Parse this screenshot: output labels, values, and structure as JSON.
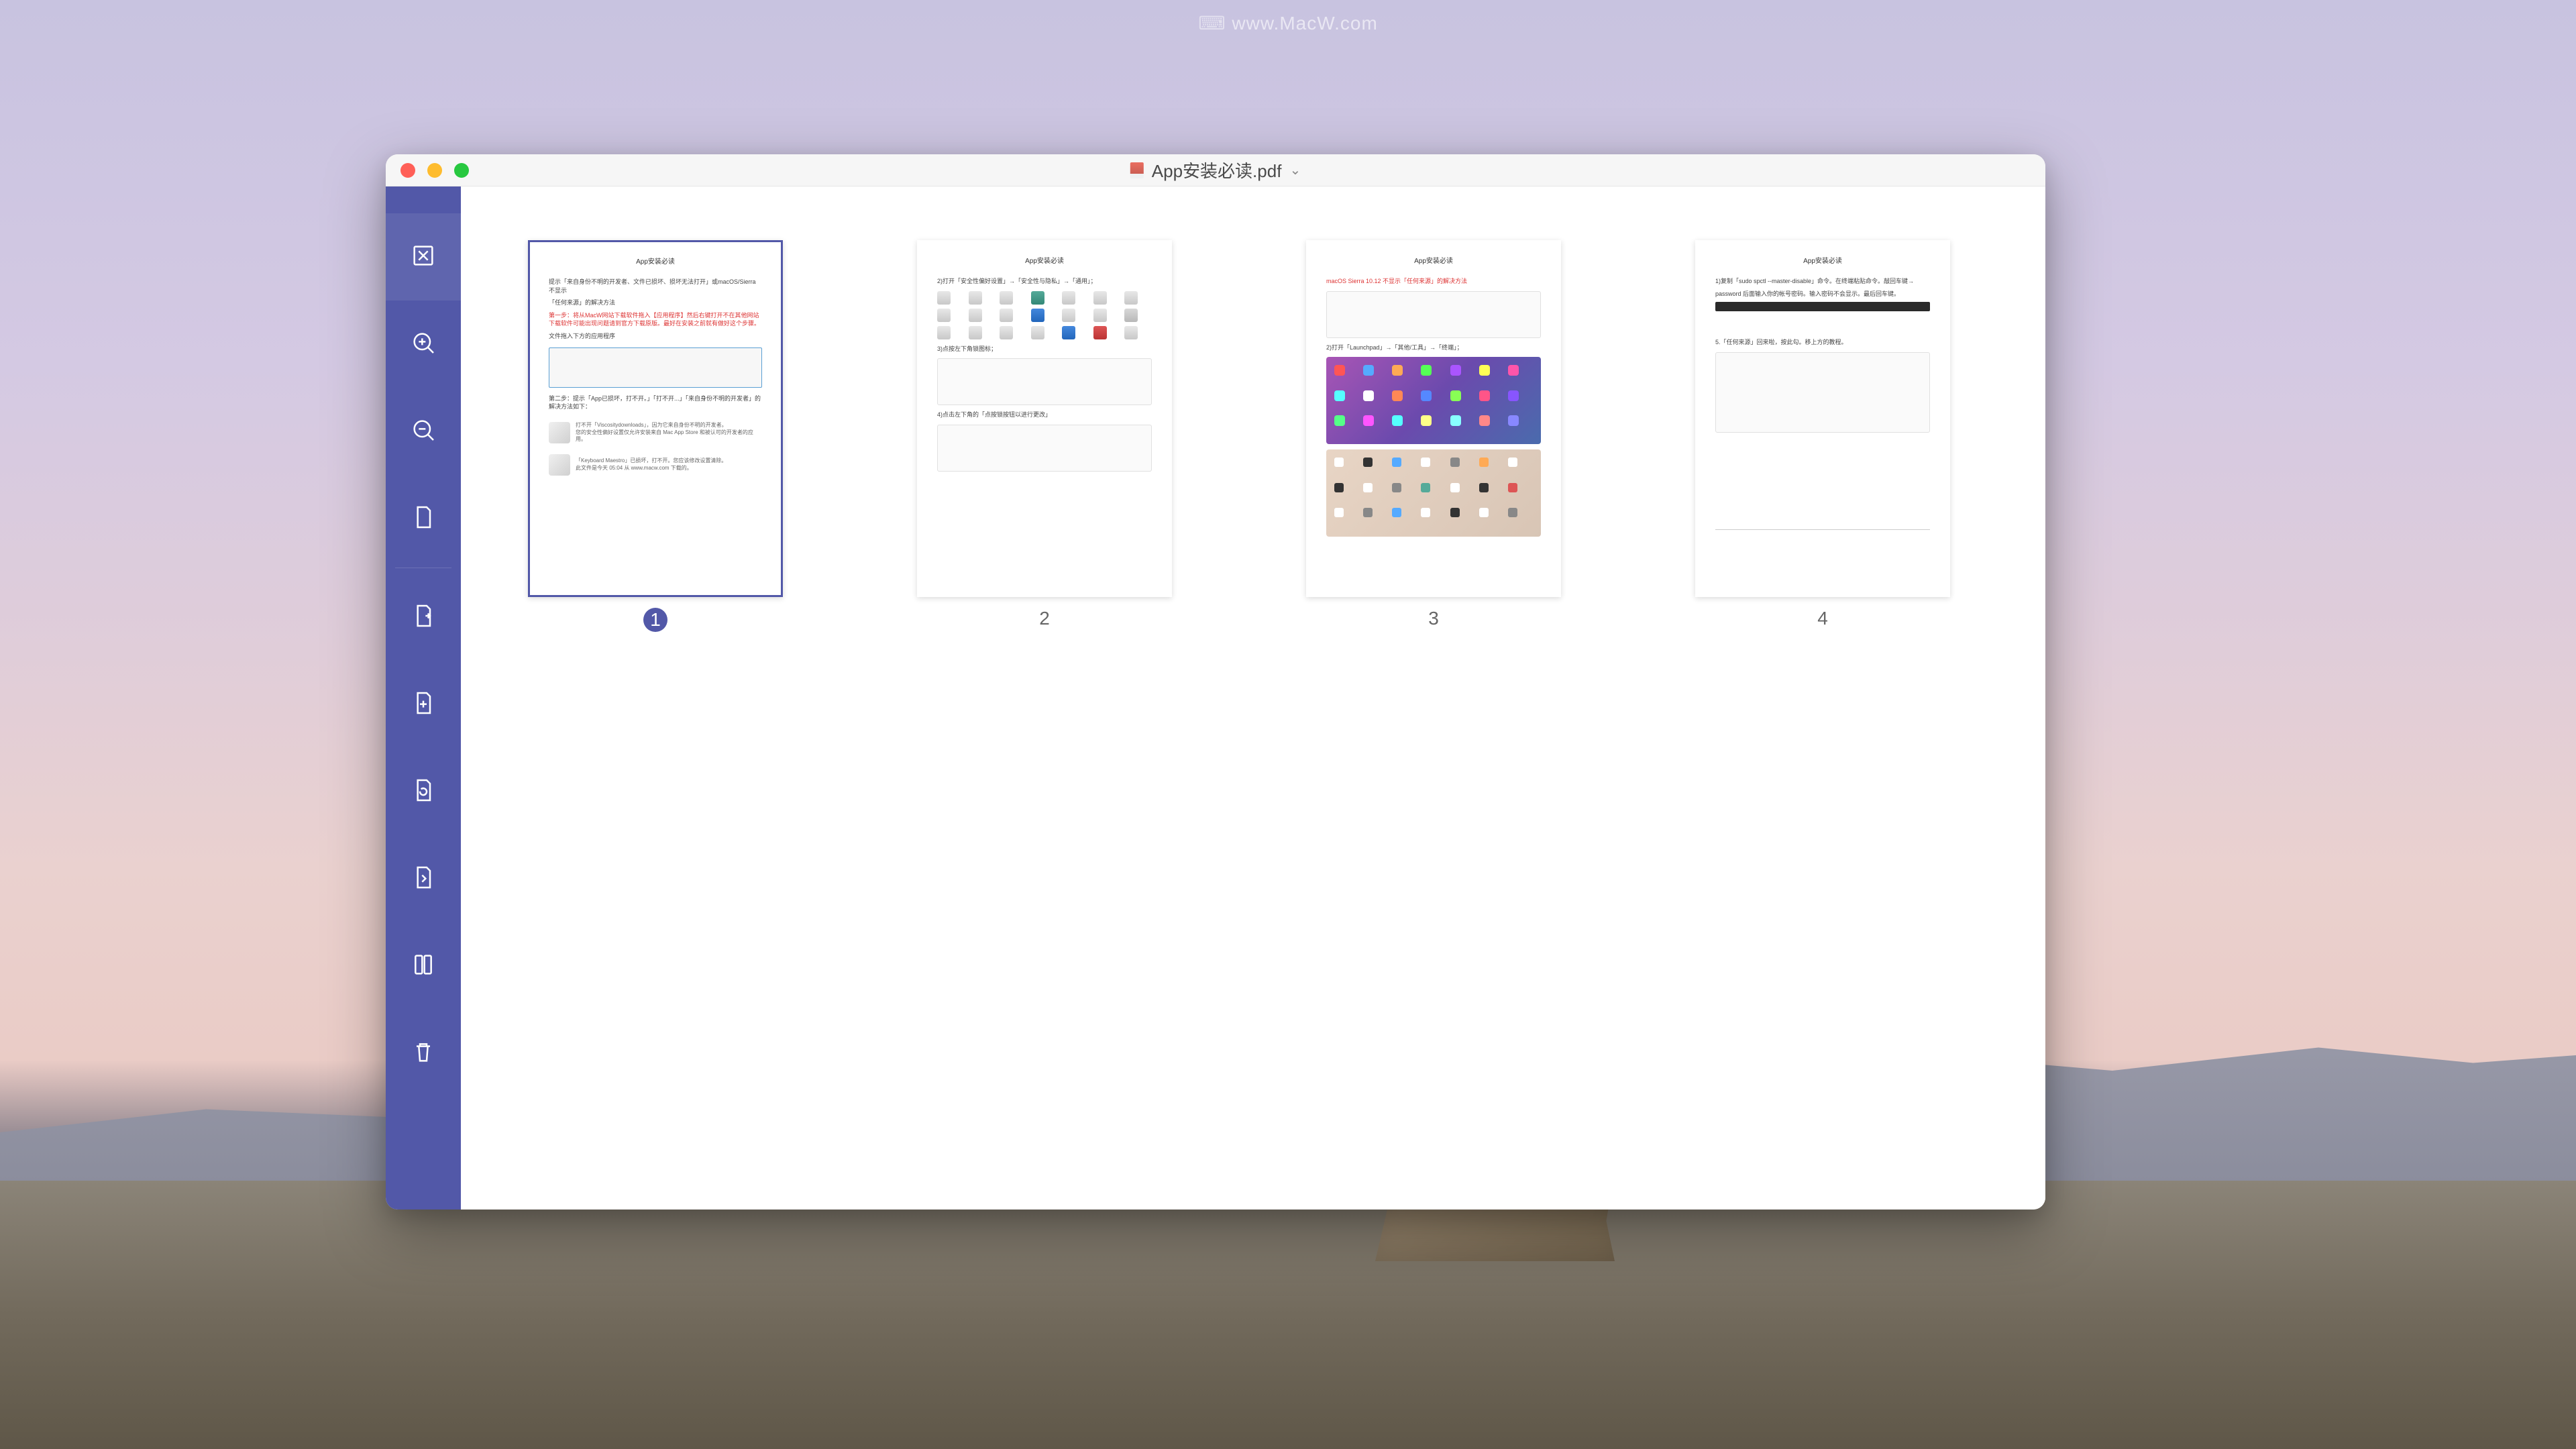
{
  "watermark": "www.MacW.com",
  "window": {
    "title": "App安装必读.pdf",
    "page_header": "App安装必读"
  },
  "sidebar": {
    "tools": [
      {
        "name": "contact-sheet",
        "active": true
      },
      {
        "name": "zoom-in",
        "active": false
      },
      {
        "name": "zoom-out",
        "active": false
      },
      {
        "name": "page-blank",
        "active": false
      },
      {
        "name": "page-extract",
        "active": false
      },
      {
        "name": "page-insert",
        "active": false
      },
      {
        "name": "page-replace",
        "active": false
      },
      {
        "name": "page-rotate",
        "active": false
      },
      {
        "name": "page-split",
        "active": false
      },
      {
        "name": "delete",
        "active": false
      }
    ]
  },
  "pages": [
    {
      "number": "1",
      "selected": true
    },
    {
      "number": "2",
      "selected": false
    },
    {
      "number": "3",
      "selected": false
    },
    {
      "number": "4",
      "selected": false
    }
  ],
  "page1_content": {
    "line1": "提示「来自身份不明的开发者、文件已损坏、损坏无法打开」或macOS/Sierra 不显示",
    "line2": "「任何来源」的解决方法",
    "line3": "第一步：将从MacW网站下载软件拖入【应用程序】然后右键打开不在其他网站下载软件可能出现问题请到官方下载原版。最好在安装之前就有做好这个步骤。",
    "line4": "文件拖入下方的应用程序",
    "line5": "第二步：提示「App已损坏，打不开。」「打不开...」「来自身份不明的开发者」的解决方法如下：",
    "panel1_title": "打不开「Viscositydownloads」，因为它来自身份不明的开发者。",
    "panel1_line": "您的安全性偏好设置仅允许安装来自 Mac App Store 和被认可的开发者的应用。",
    "panel2_title": "「Keyboard Maestro」已损坏，打不开。您应该修改设置清除。",
    "panel2_line": "此文件是今天 05:04 从 www.macw.com 下载的。"
  },
  "page2_content": {
    "line1": "2)打开「安全性偏好设置」→「安全性与隐私」→「通用」；",
    "line2": "3)点按左下角锁图标；",
    "line3": "4)点击左下角的「点按锁按钮以进行更改」"
  },
  "page3_content": {
    "line1": "macOS Sierra 10.12 不显示「任何来源」的解决方法",
    "line2": "2)打开「Launchpad」→「其他/工具」→「终端」；"
  },
  "page4_content": {
    "line1": "1)复制「sudo spctl --master-disable」命令。在终端粘贴命令。敲回车键→",
    "line2": "password 后面输入你的帐号密码。输入密码不会显示。最后回车键。",
    "line3": "5.「任何来源」回来啦，按此勾。移上方的教程。"
  }
}
